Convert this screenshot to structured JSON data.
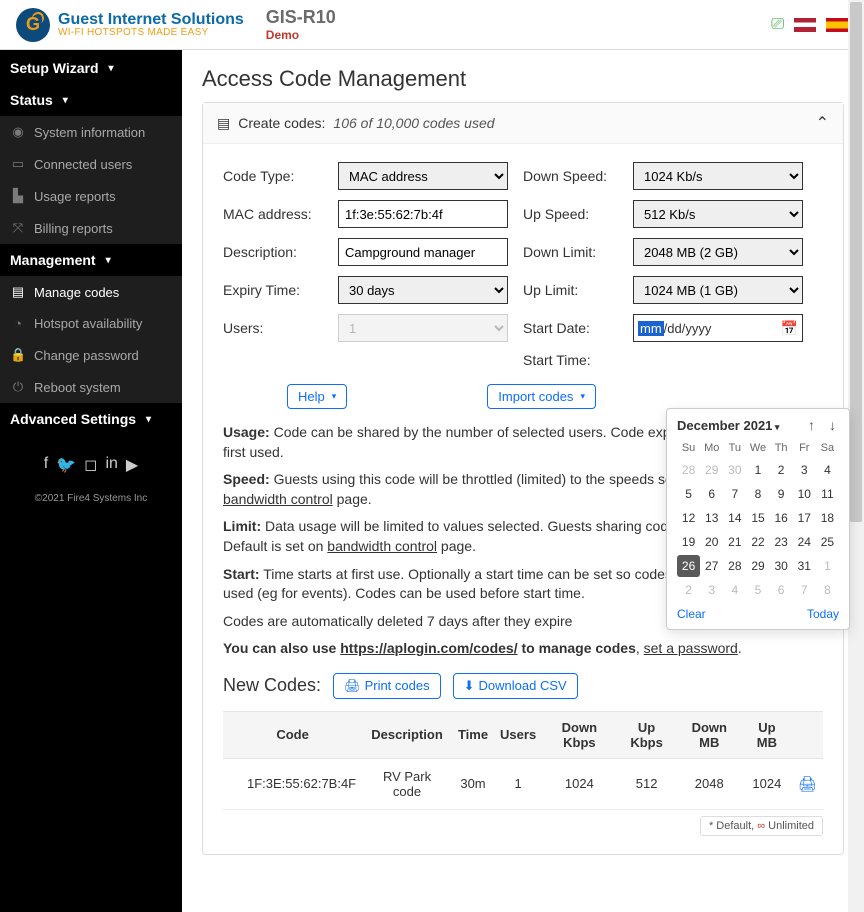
{
  "brand": {
    "line1": "Guest Internet Solutions",
    "line2": "WI-FI HOTSPOTS MADE EASY"
  },
  "product": {
    "name": "GIS-R10",
    "tag": "Demo"
  },
  "sidebar": {
    "heads": {
      "setup": "Setup Wizard",
      "status": "Status",
      "management": "Management",
      "advanced": "Advanced Settings"
    },
    "status_items": [
      "System information",
      "Connected users",
      "Usage reports",
      "Billing reports"
    ],
    "mgmt_items": [
      "Manage codes",
      "Hotspot availability",
      "Change password",
      "Reboot system"
    ]
  },
  "copyright": "©2021 Fire4 Systems Inc",
  "page_title": "Access Code Management",
  "panel": {
    "title_prefix": "Create codes:",
    "title_em": "106 of 10,000 codes used"
  },
  "form": {
    "left": {
      "code_type": {
        "label": "Code Type:",
        "value": "MAC address"
      },
      "mac": {
        "label": "MAC address:",
        "value": "1f:3e:55:62:7b:4f"
      },
      "desc": {
        "label": "Description:",
        "value": "Campground manager"
      },
      "expiry": {
        "label": "Expiry Time:",
        "value": "30 days"
      },
      "users": {
        "label": "Users:",
        "value": "1"
      }
    },
    "right": {
      "down_speed": {
        "label": "Down Speed:",
        "value": "1024 Kb/s"
      },
      "up_speed": {
        "label": "Up Speed:",
        "value": "512 Kb/s"
      },
      "down_limit": {
        "label": "Down Limit:",
        "value": "2048 MB (2 GB)"
      },
      "up_limit": {
        "label": "Up Limit:",
        "value": "1024 MB (1 GB)"
      },
      "start_date": {
        "label": "Start Date:",
        "seg1": "mm",
        "seg2": "/dd/yyyy"
      },
      "start_time": {
        "label": "Start Time:"
      }
    }
  },
  "buttons": {
    "help": "Help",
    "import": "Import codes",
    "print": "Print codes",
    "download": "Download CSV"
  },
  "desc": {
    "usage_b": "Usage:",
    "usage_t": " Code can be shared by the number of selected users. Code expires at pre-set time after first used.",
    "speed_b": "Speed:",
    "speed_t1": " Guests using this code will be throttled (limited) to the speeds selected. Default is set on ",
    "speed_link": "bandwidth control",
    "speed_t2": " page.",
    "limit_b": "Limit:",
    "limit_t1": " Data usage will be limited to values selected. Guests sharing codes will also share limit. Default is set on ",
    "limit_link": "bandwidth control",
    "limit_t2": " page.",
    "start_b": "Start:",
    "start_t": " Time starts at first use. Optionally a start time can be set so codes expire without being used (eg for events). Codes can be used before start time.",
    "auto": "Codes are automatically deleted 7 days after they expire",
    "also1": "You can also use ",
    "also_link": "https://aplogin.com/codes/",
    "also2": " to manage codes",
    "also3": ", ",
    "also_pw": "set a password",
    "also4": "."
  },
  "newcodes_title": "New Codes:",
  "table": {
    "headers": [
      "Code",
      "Description",
      "Time",
      "Users",
      "Down Kbps",
      "Up Kbps",
      "Down MB",
      "Up MB",
      ""
    ],
    "row": [
      "1F:3E:55:62:7B:4F",
      "RV Park code",
      "30m",
      "1",
      "1024",
      "512",
      "2048",
      "1024"
    ]
  },
  "legend": {
    "star": "* Default,",
    "inf": "∞",
    "unl": " Unlimited"
  },
  "datepicker": {
    "title": "December 2021",
    "dow": [
      "Su",
      "Mo",
      "Tu",
      "We",
      "Th",
      "Fr",
      "Sa"
    ],
    "rows": [
      [
        {
          "n": 28,
          "m": 1
        },
        {
          "n": 29,
          "m": 1
        },
        {
          "n": 30,
          "m": 1
        },
        {
          "n": 1
        },
        {
          "n": 2
        },
        {
          "n": 3
        },
        {
          "n": 4
        }
      ],
      [
        {
          "n": 5
        },
        {
          "n": 6
        },
        {
          "n": 7
        },
        {
          "n": 8
        },
        {
          "n": 9
        },
        {
          "n": 10
        },
        {
          "n": 11
        }
      ],
      [
        {
          "n": 12
        },
        {
          "n": 13
        },
        {
          "n": 14
        },
        {
          "n": 15
        },
        {
          "n": 16
        },
        {
          "n": 17
        },
        {
          "n": 18
        }
      ],
      [
        {
          "n": 19
        },
        {
          "n": 20
        },
        {
          "n": 21
        },
        {
          "n": 22
        },
        {
          "n": 23
        },
        {
          "n": 24
        },
        {
          "n": 25
        }
      ],
      [
        {
          "n": 26,
          "t": 1
        },
        {
          "n": 27
        },
        {
          "n": 28
        },
        {
          "n": 29
        },
        {
          "n": 30
        },
        {
          "n": 31
        },
        {
          "n": 1,
          "m": 1
        }
      ],
      [
        {
          "n": 2,
          "m": 1
        },
        {
          "n": 3,
          "m": 1
        },
        {
          "n": 4,
          "m": 1
        },
        {
          "n": 5,
          "m": 1
        },
        {
          "n": 6,
          "m": 1
        },
        {
          "n": 7,
          "m": 1
        },
        {
          "n": 8,
          "m": 1
        }
      ]
    ],
    "clear": "Clear",
    "today": "Today"
  }
}
